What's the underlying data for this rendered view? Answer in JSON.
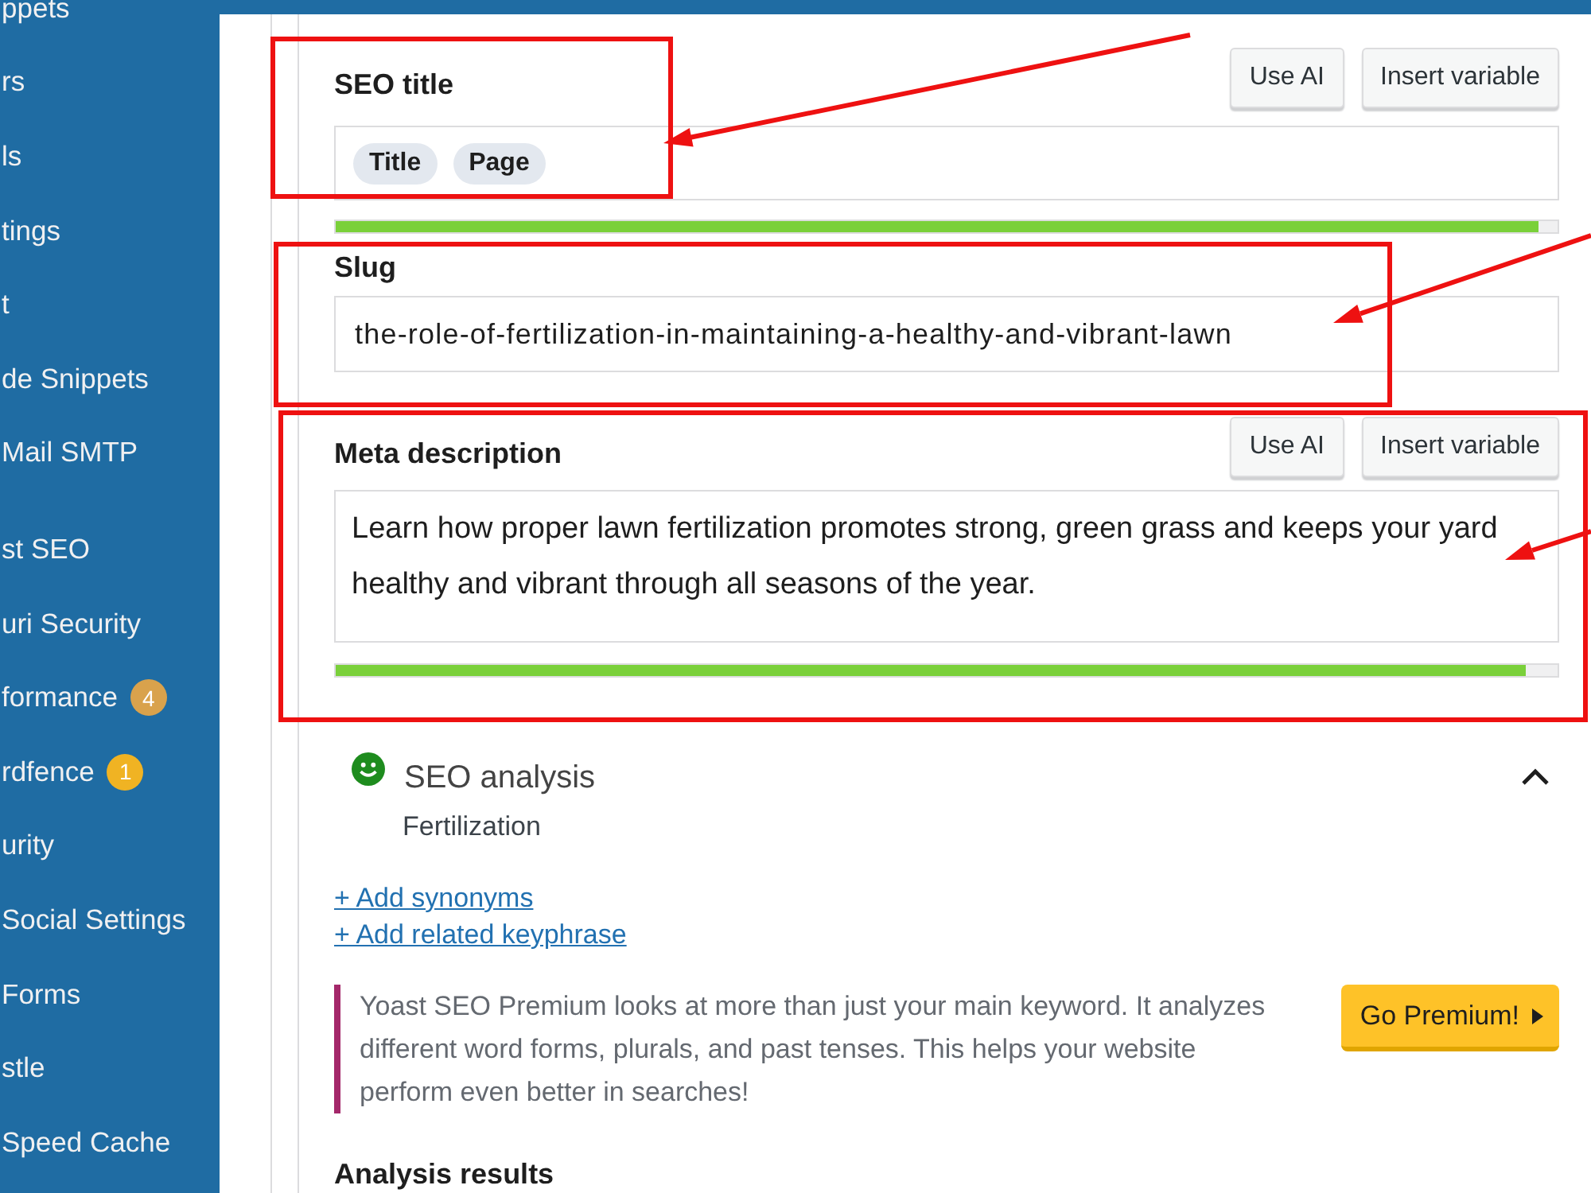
{
  "sidebar": {
    "sections": [
      {
        "items": [
          {
            "label": "ppets"
          },
          {
            "label": "rs"
          },
          {
            "label": "ls"
          },
          {
            "label": "tings"
          },
          {
            "label": "t"
          },
          {
            "label": "de Snippets"
          },
          {
            "label": "Mail SMTP"
          }
        ]
      },
      {
        "items": [
          {
            "label": "st SEO"
          },
          {
            "label": "uri Security"
          },
          {
            "label": "formance",
            "badge": {
              "count": "4",
              "color": "#d9a24c"
            }
          },
          {
            "label": "rdfence",
            "badge": {
              "count": "1",
              "color": "#f0b323"
            }
          },
          {
            "label": "urity"
          },
          {
            "label": "Social Settings"
          },
          {
            "label": "Forms"
          },
          {
            "label": "stle"
          },
          {
            "label": "Speed Cache"
          }
        ]
      }
    ]
  },
  "seo_title": {
    "label": "SEO title",
    "buttons": [
      "Use AI",
      "Insert variable"
    ],
    "variables": [
      "Title",
      "Page"
    ],
    "level": 0.985
  },
  "slug": {
    "label": "Slug",
    "value": "the-role-of-fertilization-in-maintaining-a-healthy-and-vibrant-lawn"
  },
  "meta_description": {
    "label": "Meta description",
    "buttons": [
      "Use AI",
      "Insert variable"
    ],
    "value": "Learn how proper lawn fertilization promotes strong, green grass and keeps your yard healthy and vibrant through all seasons of the year.",
    "level": 0.974
  },
  "seo_analysis": {
    "title": "SEO analysis",
    "keyphrase": "Fertilization",
    "expanded": true,
    "links": [
      "+ Add synonyms",
      "+ Add related keyphrase"
    ],
    "premium_notice": {
      "text": "Yoast SEO Premium looks at more than just your main keyword. It analyzes different word forms, plurals, and past tenses. This helps your website perform even better in searches!",
      "button": "Go Premium!"
    }
  },
  "analysis_results": {
    "heading": "Analysis results"
  }
}
